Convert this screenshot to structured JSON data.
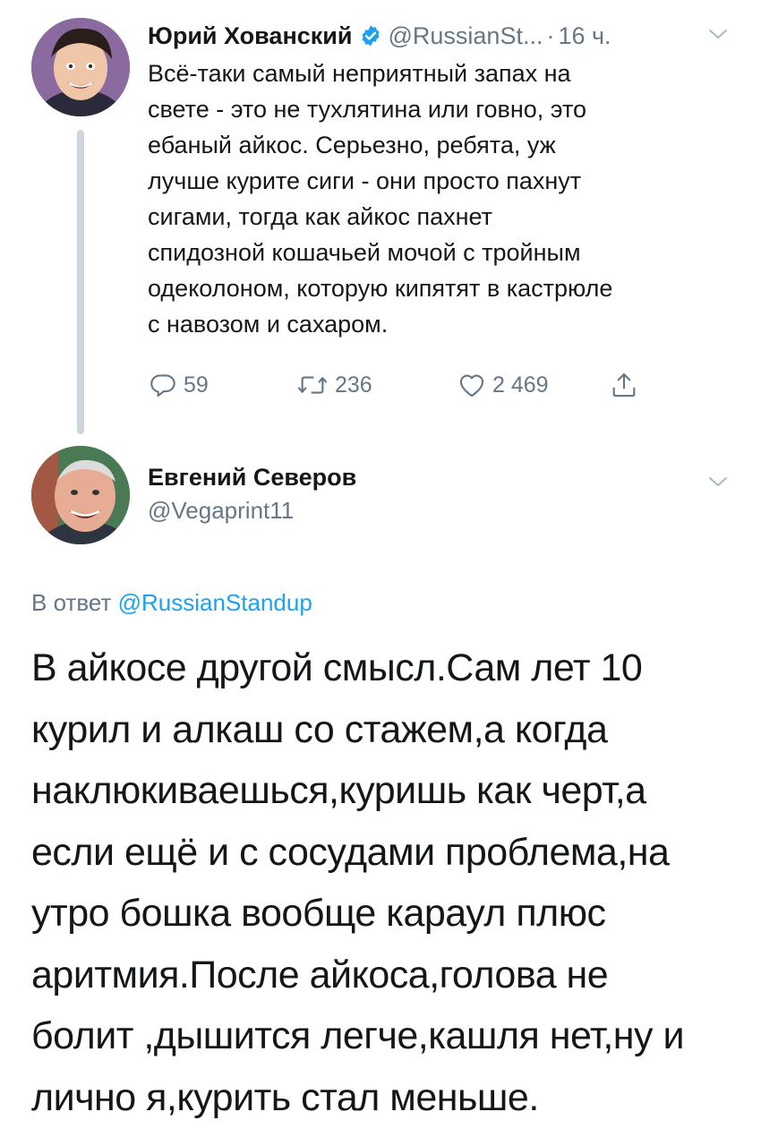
{
  "tweet": {
    "author_name": "Юрий Хованский",
    "handle": "@RussianSt...",
    "separator": "·",
    "time": "16 ч.",
    "text_lines": [
      "Всё-таки самый неприятный запах на",
      "свете - это не тухлятина или говно, это",
      "ебаный айкос. Серьезно, ребята, уж",
      "лучше курите сиги - они просто пахнут",
      "сигами, тогда как айкос пахнет",
      "спидозной кошачьей мочой с тройным",
      "одеколоном, которую кипятят в кастрюле",
      "с навозом и сахаром."
    ],
    "replies": "59",
    "retweets": "236",
    "likes": "2 469",
    "icons": {
      "verified": "verified-badge-icon",
      "reply": "reply-icon",
      "retweet": "retweet-icon",
      "like": "heart-icon",
      "share": "share-icon",
      "menu": "chevron-down-icon"
    }
  },
  "reply": {
    "author_name": "Евгений Северов",
    "handle": "@Vegaprint11",
    "replying_prefix": "В ответ",
    "replying_to": "@RussianStandup",
    "text_lines": [
      "В айкосе другой смысл.Сам лет 10",
      "курил и алкаш со стажем,а когда",
      "наклюкиваешься,куришь как черт,а",
      "если ещё и с сосудами проблема,на",
      "утро бошка вообще караул плюс",
      "аритмия.После айкоса,голова не",
      "болит ,дышится легче,кашля нет,ну и",
      "лично я,курить стал меньше."
    ]
  },
  "colors": {
    "text": "#14171a",
    "secondary": "#657786",
    "link": "#1da1f2",
    "thread_line": "#cdd6dd"
  }
}
